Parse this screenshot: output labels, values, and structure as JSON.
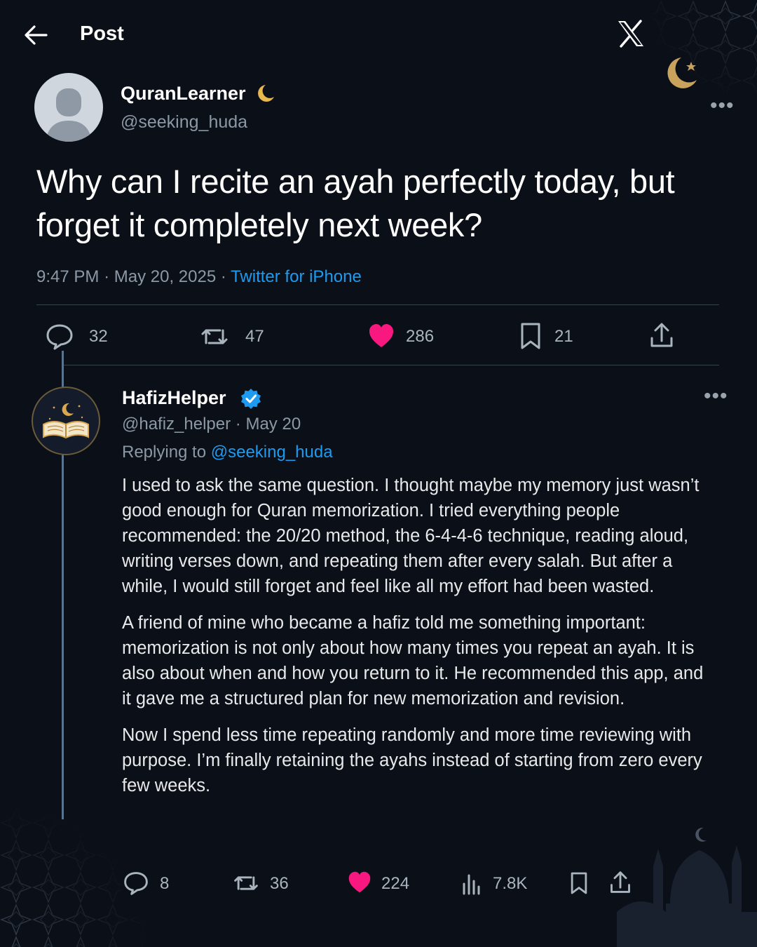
{
  "header": {
    "title": "Post"
  },
  "main_post": {
    "display_name": "QuranLearner",
    "handle": "@seeking_huda",
    "text": "Why can I recite an ayah perfectly today, but forget it completely next week?",
    "time": "9:47 PM",
    "date": "May 20, 2025",
    "source": "Twitter for iPhone",
    "stats": {
      "replies": "32",
      "reposts": "47",
      "likes": "286",
      "bookmarks": "21"
    }
  },
  "reply": {
    "display_name": "HafizHelper",
    "handle": "@hafiz_helper",
    "date": "May 20",
    "replying_prefix": "Replying to",
    "replying_to": "@seeking_huda",
    "paragraphs": [
      "I used to ask the same question. I thought maybe my memory just wasn’t good enough for Quran memorization. I tried everything people recommended: the 20/20 method, the 6-4-4-6 technique, reading aloud, writing verses down, and repeating them after every salah. But after a while, I would still forget and feel like all my effort had been wasted.",
      "A friend of mine who became a hafiz told me something important: memorization is not only about how many times you repeat an ayah. It is also about when and how you return to it. He recommended this app, and it gave me a structured plan for new memorization and revision.",
      "Now I spend less time repeating randomly and more time reviewing with purpose. I’m finally retaining the ayahs instead of starting from zero every few weeks."
    ],
    "stats": {
      "replies": "8",
      "reposts": "36",
      "likes": "224",
      "views": "7.8K"
    }
  },
  "colors": {
    "background": "#0b0f17",
    "accent": "#1d9bf0",
    "like": "#f91880",
    "gold": "#c9a25c",
    "muted": "#8b98a5"
  },
  "icons": [
    "back-arrow-icon",
    "x-logo-icon",
    "crescent-star-icon",
    "more-icon",
    "reply-icon",
    "repost-icon",
    "like-icon",
    "bookmark-icon",
    "share-icon",
    "views-icon",
    "verified-icon",
    "quran-book-icon"
  ]
}
